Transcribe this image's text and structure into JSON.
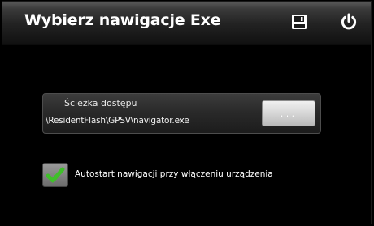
{
  "header": {
    "title": "Wybierz nawigacje Exe",
    "save_icon": "save-icon",
    "power_icon": "power-icon"
  },
  "path": {
    "label": "Ścieżka dostępu",
    "value": "\\ResidentFlash\\GPSV\\navigator.exe",
    "browse_label": "..."
  },
  "autostart": {
    "checked": true,
    "label": "Autostart nawigacji przy włączeniu urządzenia"
  },
  "colors": {
    "checkmark": "#3fbf2a",
    "background": "#000000"
  }
}
